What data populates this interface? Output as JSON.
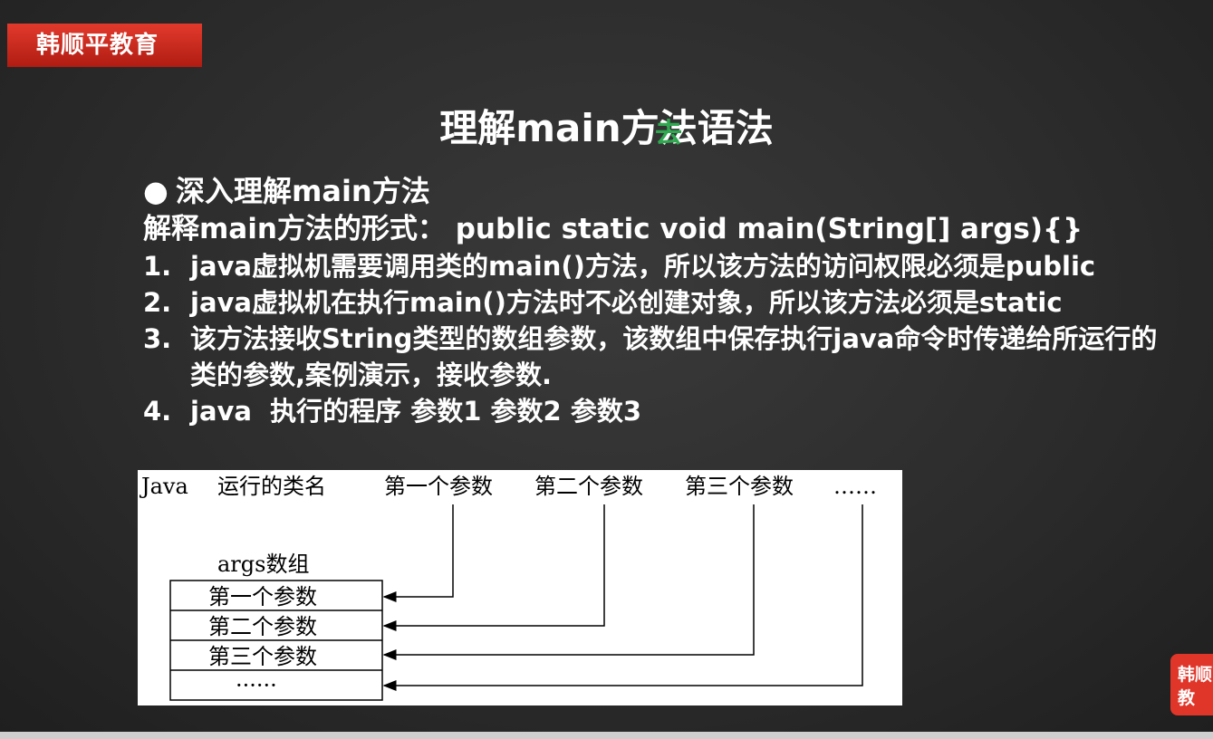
{
  "brand": {
    "label": "韩顺平教育"
  },
  "slide": {
    "title": "理解main方法语法",
    "cursor_glyph": "去",
    "bullet": "深入理解main方法",
    "form_line": "解释main方法的形式： public static void main(String[] args){}",
    "items": [
      {
        "num": "1.",
        "text": "java虚拟机需要调用类的main()方法，所以该方法的访问权限必须是public"
      },
      {
        "num": "2.",
        "text": "java虚拟机在执行main()方法时不必创建对象，所以该方法必须是static"
      },
      {
        "num": "3.",
        "text": "该方法接收String类型的数组参数，该数组中保存执行java命令时传递给所运行的类的参数,案例演示，接收参数."
      },
      {
        "num": "4.",
        "text": "java  执行的程序 参数1 参数2 参数3"
      }
    ]
  },
  "diagram": {
    "header": {
      "java": "Java",
      "classname": "运行的类名",
      "args": [
        "第一个参数",
        "第二个参数",
        "第三个参数",
        "……"
      ]
    },
    "array_label": "args数组",
    "cells": [
      "第一个参数",
      "第二个参数",
      "第三个参数",
      "······"
    ]
  },
  "side_logo": {
    "line1": "韩顺",
    "line2": "教"
  }
}
